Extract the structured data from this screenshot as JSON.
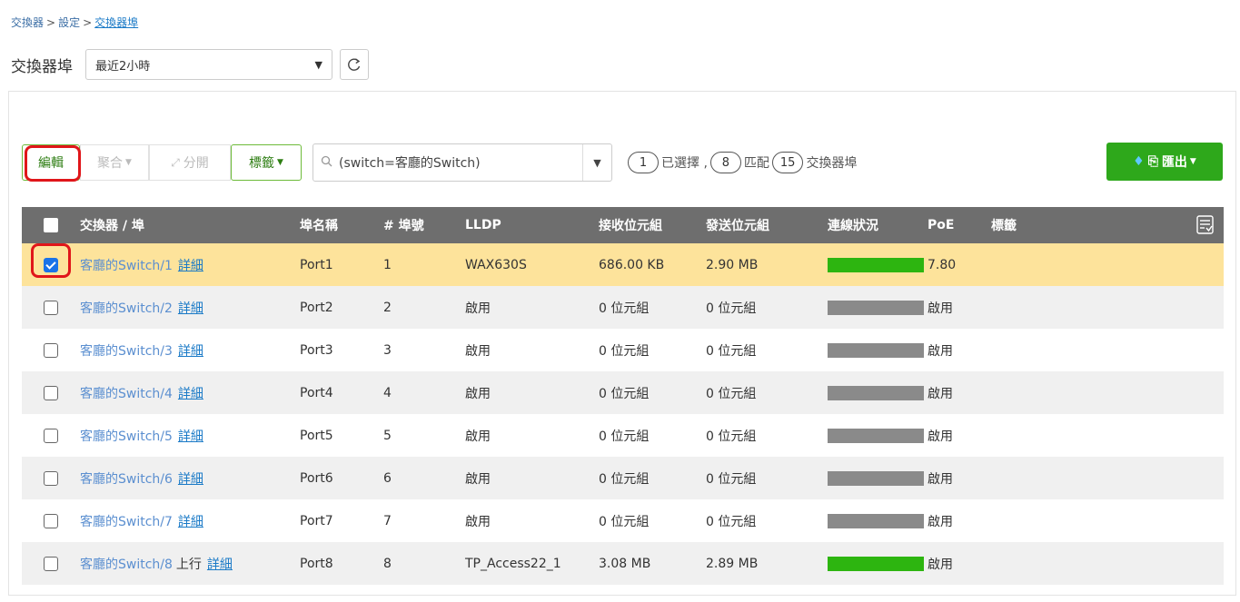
{
  "breadcrumb": {
    "root": "交換器",
    "settings": "設定",
    "current": "交換器埠",
    "sep": ">"
  },
  "page": {
    "title": "交換器埠",
    "time_range": "最近2小時"
  },
  "toolbar": {
    "edit": "編輯",
    "merge": "聚合",
    "split": "分開",
    "tag": "標籤",
    "search_value": "(switch=客廳的Switch)",
    "selected_count": "1",
    "selected_label": "已選擇 ,",
    "matched_count": "8",
    "matched_label": "匹配",
    "total_count": "15",
    "total_label": "交換器埠",
    "export": "匯出"
  },
  "table": {
    "headers": {
      "switch_port": "交換器 / 埠",
      "port_name": "埠名稱",
      "port_no": "# 埠號",
      "lldp": "LLDP",
      "rx": "接收位元組",
      "tx": "發送位元組",
      "link": "連線狀況",
      "poe": "PoE",
      "tag": "標籤"
    },
    "detail_label": "詳細",
    "rows": [
      {
        "switch": "客廳的Switch/1",
        "uplink": "",
        "port_name": "Port1",
        "port_no": "1",
        "lldp": "WAX630S",
        "rx": "686.00 KB",
        "tx": "2.90 MB",
        "link": "up",
        "poe": "7.80",
        "checked": true
      },
      {
        "switch": "客廳的Switch/2",
        "uplink": "",
        "port_name": "Port2",
        "port_no": "2",
        "lldp": "啟用",
        "rx": "0 位元組",
        "tx": "0 位元組",
        "link": "down",
        "poe": "啟用",
        "checked": false
      },
      {
        "switch": "客廳的Switch/3",
        "uplink": "",
        "port_name": "Port3",
        "port_no": "3",
        "lldp": "啟用",
        "rx": "0 位元組",
        "tx": "0 位元組",
        "link": "down",
        "poe": "啟用",
        "checked": false
      },
      {
        "switch": "客廳的Switch/4",
        "uplink": "",
        "port_name": "Port4",
        "port_no": "4",
        "lldp": "啟用",
        "rx": "0 位元組",
        "tx": "0 位元組",
        "link": "down",
        "poe": "啟用",
        "checked": false
      },
      {
        "switch": "客廳的Switch/5",
        "uplink": "",
        "port_name": "Port5",
        "port_no": "5",
        "lldp": "啟用",
        "rx": "0 位元組",
        "tx": "0 位元組",
        "link": "down",
        "poe": "啟用",
        "checked": false
      },
      {
        "switch": "客廳的Switch/6",
        "uplink": "",
        "port_name": "Port6",
        "port_no": "6",
        "lldp": "啟用",
        "rx": "0 位元組",
        "tx": "0 位元組",
        "link": "down",
        "poe": "啟用",
        "checked": false
      },
      {
        "switch": "客廳的Switch/7",
        "uplink": "",
        "port_name": "Port7",
        "port_no": "7",
        "lldp": "啟用",
        "rx": "0 位元組",
        "tx": "0 位元組",
        "link": "down",
        "poe": "啟用",
        "checked": false
      },
      {
        "switch": "客廳的Switch/8",
        "uplink": "上行",
        "port_name": "Port8",
        "port_no": "8",
        "lldp": "TP_Access22_1",
        "rx": "3.08 MB",
        "tx": "2.89 MB",
        "link": "up",
        "poe": "啟用",
        "checked": false
      }
    ]
  },
  "colors": {
    "accent_green": "#2ea81b",
    "link_up": "#2db510",
    "link_down": "#8a8a8a",
    "selected_row": "#fde39b",
    "highlight": "#e0161a"
  }
}
